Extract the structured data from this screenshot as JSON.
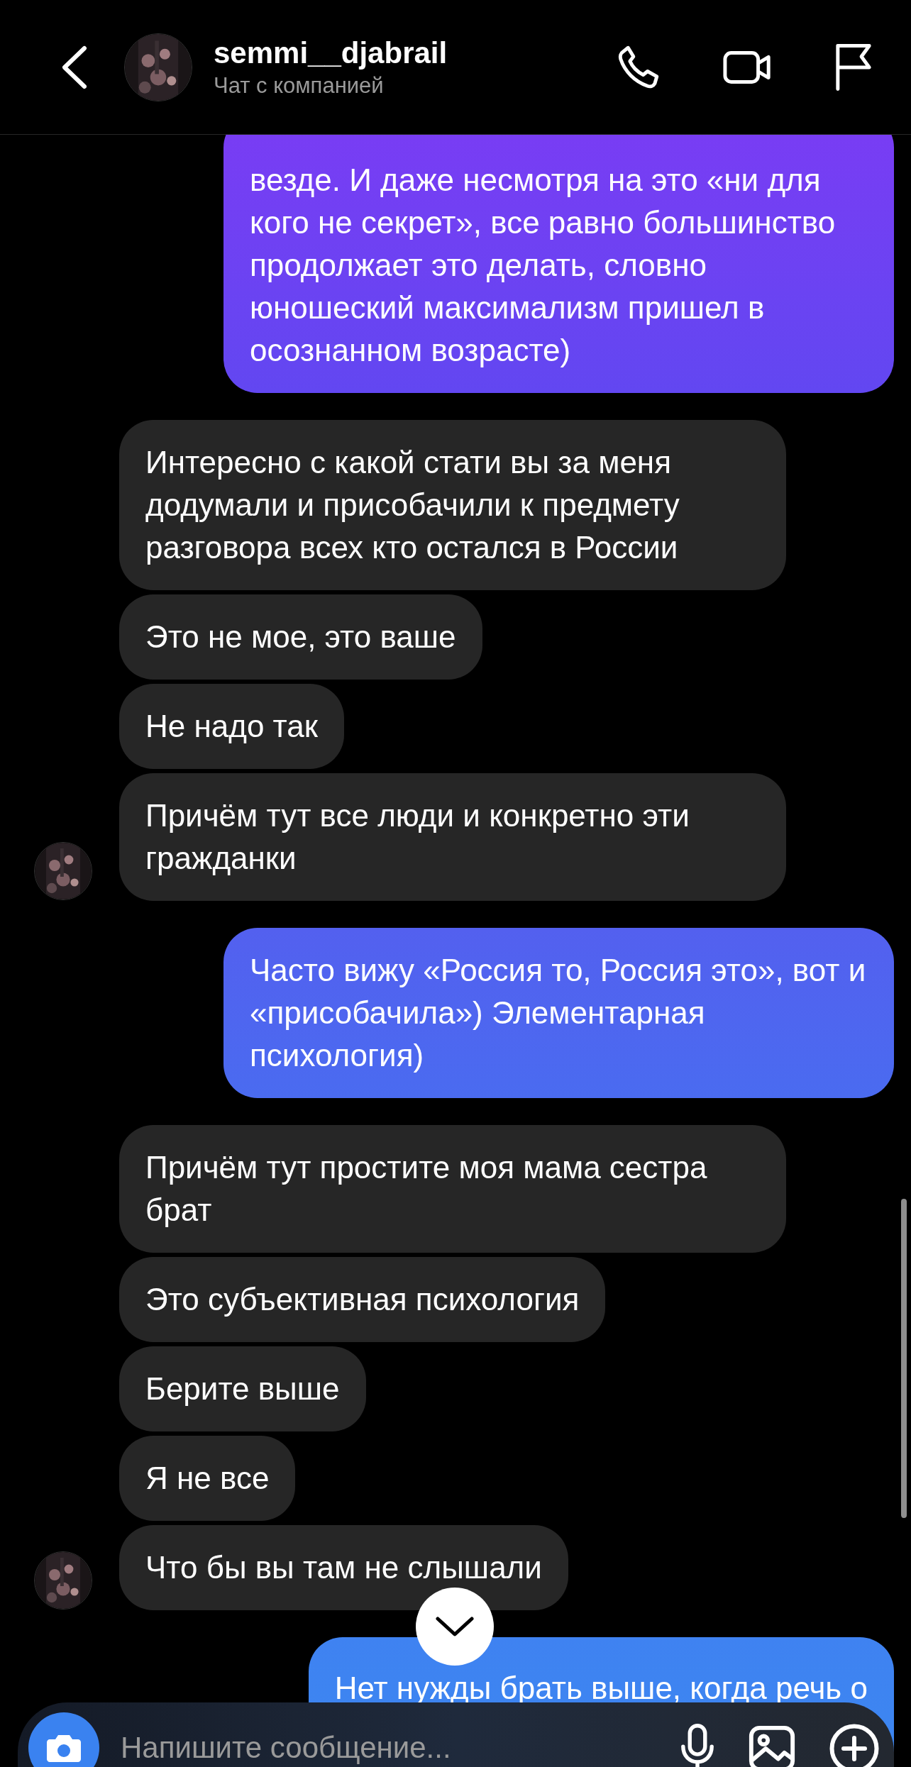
{
  "header": {
    "name": "semmi__djabrail",
    "subtitle": "Чат с компанией"
  },
  "messages": [
    {
      "kind": "sent",
      "text": "везде. И даже несмотря на это «ни для кого не секрет», все равно большинство продолжает это делать, словно юношеский максимализм пришел в осознанном возрасте)"
    },
    {
      "kind": "received",
      "text": "Интересно с какой стати вы за меня додумали и присобачили к предмету разговора всех кто остался в России",
      "avatar": false
    },
    {
      "kind": "received",
      "text": "Это не мое, это ваше",
      "avatar": false
    },
    {
      "kind": "received",
      "text": "Не надо так",
      "avatar": false
    },
    {
      "kind": "received",
      "text": "Причём тут все люди и конкретно эти гражданки",
      "avatar": true
    },
    {
      "kind": "sent",
      "text": "Часто вижу «Россия то, Россия это», вот и «присобачила») Элементарная психология)"
    },
    {
      "kind": "received",
      "text": "Причём тут простите моя мама сестра брат",
      "avatar": false
    },
    {
      "kind": "received",
      "text": "Это субъективная психология",
      "avatar": false
    },
    {
      "kind": "received",
      "text": "Берите выше",
      "avatar": false
    },
    {
      "kind": "received",
      "text": "Я не все",
      "avatar": false
    },
    {
      "kind": "received",
      "text": "Что бы вы там не слышали",
      "avatar": true
    },
    {
      "kind": "sent",
      "text": "Нет нужды брать выше, когда речь о"
    }
  ],
  "composer": {
    "placeholder": "Напишите сообщение..."
  }
}
